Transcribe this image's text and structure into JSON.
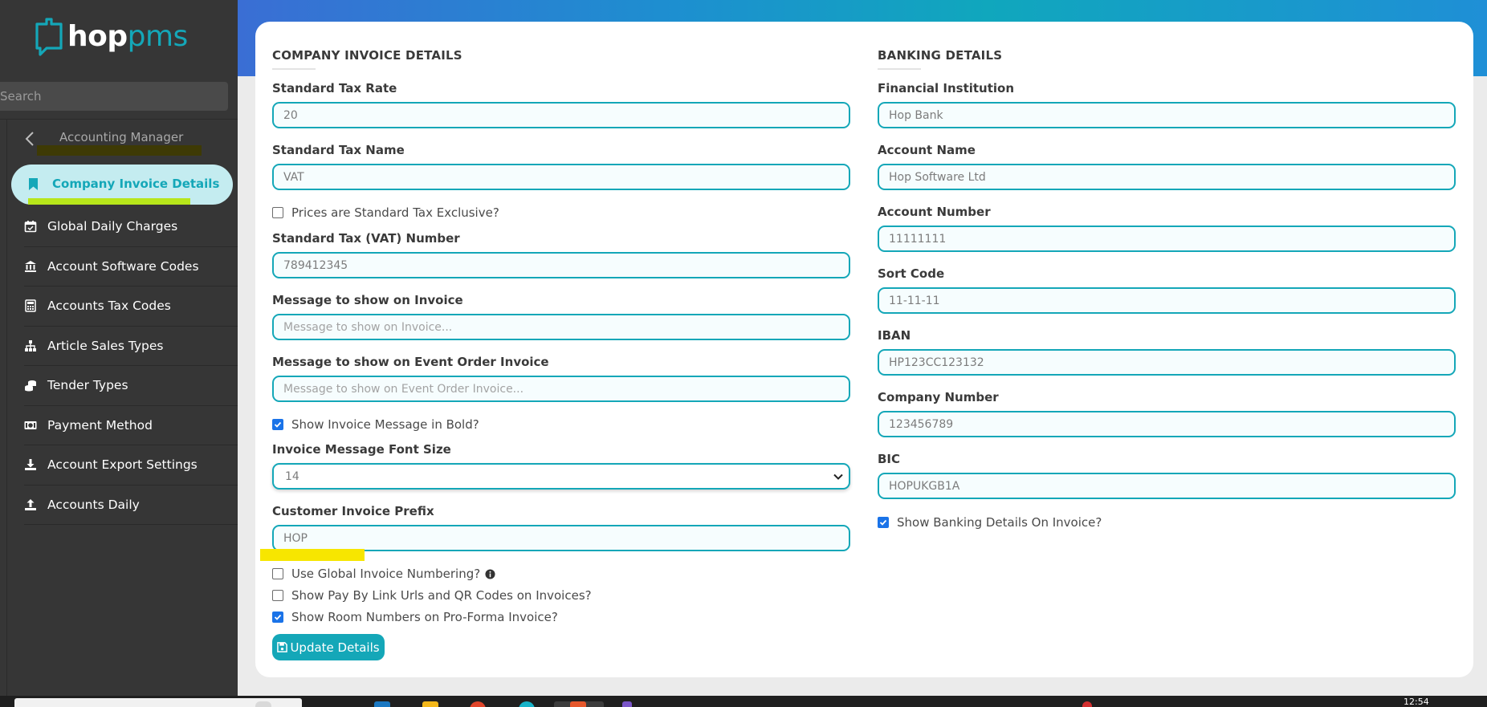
{
  "app": {
    "logo_hop": "hop",
    "logo_pms": "pms",
    "search_placeholder": "Search",
    "brand_color": "#14a7b8"
  },
  "sidebar": {
    "header_title": "Accounting Manager",
    "active_item": "Company Invoice Details",
    "items": [
      {
        "label": "Global Daily Charges",
        "icon": "calendar-check-icon"
      },
      {
        "label": "Account Software Codes",
        "icon": "bank-icon"
      },
      {
        "label": "Accounts Tax Codes",
        "icon": "calculator-icon"
      },
      {
        "label": "Article Sales Types",
        "icon": "sitemap-icon"
      },
      {
        "label": "Tender Types",
        "icon": "coins-icon"
      },
      {
        "label": "Payment Method",
        "icon": "money-bill-icon"
      },
      {
        "label": "Account Export Settings",
        "icon": "download-icon"
      },
      {
        "label": "Accounts Daily",
        "icon": "upload-icon"
      }
    ]
  },
  "invoice": {
    "section_title": "COMPANY INVOICE DETAILS",
    "tax_rate_label": "Standard Tax Rate",
    "tax_rate_value": "20",
    "tax_name_label": "Standard Tax Name",
    "tax_name_value": "VAT",
    "tax_exclusive_label": "Prices are Standard Tax Exclusive?",
    "tax_exclusive_checked": false,
    "vat_number_label": "Standard Tax (VAT) Number",
    "vat_number_value": "789412345",
    "invoice_message_label": "Message to show on Invoice",
    "invoice_message_placeholder": "Message to show on Invoice...",
    "event_message_label": "Message to show on Event Order Invoice",
    "event_message_placeholder": "Message to show on Event Order Invoice...",
    "bold_message_label": "Show Invoice Message in Bold?",
    "bold_message_checked": true,
    "font_size_label": "Invoice Message Font Size",
    "font_size_value": "14",
    "prefix_label": "Customer Invoice Prefix",
    "prefix_value": "HOP",
    "global_numbering_label": "Use Global Invoice Numbering?",
    "global_numbering_checked": false,
    "pay_by_link_label": "Show Pay By Link Urls and QR Codes on Invoices?",
    "pay_by_link_checked": false,
    "room_numbers_label": "Show Room Numbers on Pro-Forma Invoice?",
    "room_numbers_checked": true,
    "update_button_label": "Update Details"
  },
  "banking": {
    "section_title": "BANKING DETAILS",
    "institution_label": "Financial Institution",
    "institution_value": "Hop Bank",
    "account_name_label": "Account Name",
    "account_name_value": "Hop Software Ltd",
    "account_number_label": "Account Number",
    "account_number_value": "11111111",
    "sort_code_label": "Sort Code",
    "sort_code_value": "11-11-11",
    "iban_label": "IBAN",
    "iban_value": "HP123CC123132",
    "company_number_label": "Company Number",
    "company_number_value": "123456789",
    "bic_label": "BIC",
    "bic_value": "HOPUKGB1A",
    "show_on_invoice_label": "Show Banking Details On Invoice?",
    "show_on_invoice_checked": true
  },
  "taskbar": {
    "time": "12:54"
  }
}
